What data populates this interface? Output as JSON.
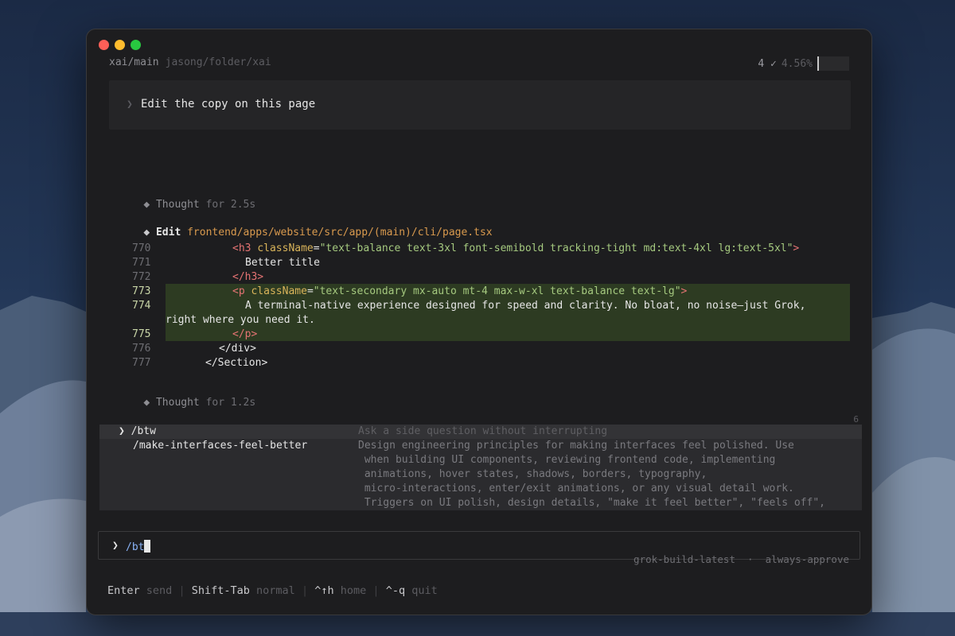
{
  "topbar": {
    "branch": "xai/main",
    "path": "jasong/folder/xai",
    "count": "4 ✓",
    "percent": "4.56%"
  },
  "prompt": {
    "chevron": "❯",
    "text": "Edit the copy on this page"
  },
  "thought1": {
    "label": "Thought",
    "rest": " for 2.5s"
  },
  "edit": {
    "label": "Edit",
    "path": "frontend/apps/website/src/app/(main)/cli/page.tsx"
  },
  "code": {
    "line_numbers": [
      "770",
      "771",
      "772",
      "773",
      "774",
      "775",
      "776",
      "777"
    ],
    "l770_open": "<h3 ",
    "l770_attr": "className",
    "l770_eq": "=",
    "l770_str": "\"text-balance text-3xl font-semibold tracking-tight md:text-4xl lg:text-5xl\"",
    "l770_close": ">",
    "l771": "Better title",
    "l772": "</h3>",
    "l773_open": "<p ",
    "l773_attr": "className",
    "l773_eq": "=",
    "l773_str": "\"text-secondary mx-auto mt-4 max-w-xl text-balance text-lg\"",
    "l773_close": ">",
    "l774a": "A terminal-native experience designed for speed and clarity. No bloat, no noise—just Grok,",
    "l774b": "right where you need it.",
    "l775": "</p>",
    "l776": "</div>",
    "l777": "</Section>"
  },
  "thought2": {
    "label": "Thought",
    "rest": " for 1.2s"
  },
  "palette": {
    "count": "6",
    "items": [
      {
        "caret": "❯",
        "command": "/btw",
        "description": "Ask a side question without interrupting"
      },
      {
        "command": "/make-interfaces-feel-better",
        "description_lines": [
          "Design engineering principles for making interfaces feel polished. Use",
          " when building UI components, reviewing frontend code, implementing",
          " animations, hover states, shadows, borders, typography,",
          " micro-interactions, enter/exit animations, or any visual detail work.",
          " Triggers on UI polish, design details, \"make it feel better\", \"feels off\","
        ]
      }
    ]
  },
  "input": {
    "chevron": "❯",
    "value": "/bt"
  },
  "model": {
    "name": "grok-build-latest",
    "separator": "·",
    "mode": "always-approve"
  },
  "footer": {
    "items": [
      {
        "key": "Enter",
        "action": "send"
      },
      {
        "key": "Shift-Tab",
        "action": "normal"
      },
      {
        "key": "^↑h",
        "action": "home"
      },
      {
        "key": "^-q",
        "action": "quit"
      }
    ],
    "separator": "|"
  },
  "icons": {
    "thought": "diamond-icon",
    "window_controls": [
      "close-dot",
      "minimize-dot",
      "zoom-dot"
    ]
  },
  "colors": {
    "window_bg": "#1d1d1f",
    "highlight_add": "#2d3b22",
    "file_path": "#d99a4e",
    "input_text": "#8ab4f8"
  }
}
